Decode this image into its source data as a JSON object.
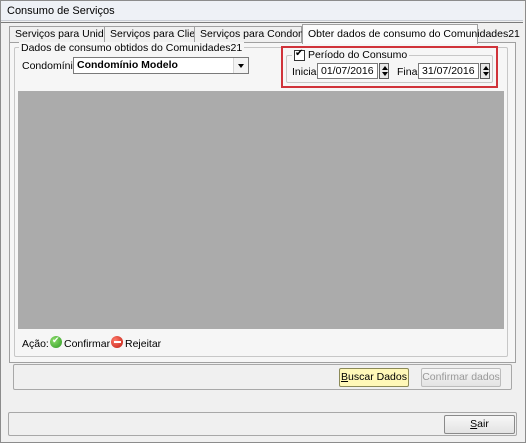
{
  "window": {
    "title": "Consumo de Serviços"
  },
  "tabs": [
    {
      "label": "Serviços para Unidades",
      "active": false
    },
    {
      "label": "Serviços para Clientes",
      "active": false
    },
    {
      "label": "Serviços para Condomínios",
      "active": false
    },
    {
      "label": "Obter dados de consumo do Comunidades21",
      "active": true
    }
  ],
  "group": {
    "legend": "Dados de consumo obtidos do Comunidades21"
  },
  "condominio": {
    "label": "Condomínio:",
    "value": "Condomínio Modelo"
  },
  "periodo": {
    "checkbox_label": "Período do Consumo",
    "checked": true,
    "inicial_label": "Inicial:",
    "inicial_value": "01/07/2016",
    "final_label": "Final:",
    "final_value": "31/07/2016"
  },
  "acao": {
    "label": "Ação:",
    "confirmar": "Confirmar",
    "rejeitar": "Rejeitar"
  },
  "buttons": {
    "buscar_prefix": "B",
    "buscar_rest": "uscar Dados",
    "confirmar_dados": "Confirmar dados",
    "sair_prefix": "S",
    "sair_rest": "air"
  },
  "colors": {
    "highlight": "#d0333a",
    "data_area": "#ababab",
    "buscar_button": "#fff8b8"
  }
}
